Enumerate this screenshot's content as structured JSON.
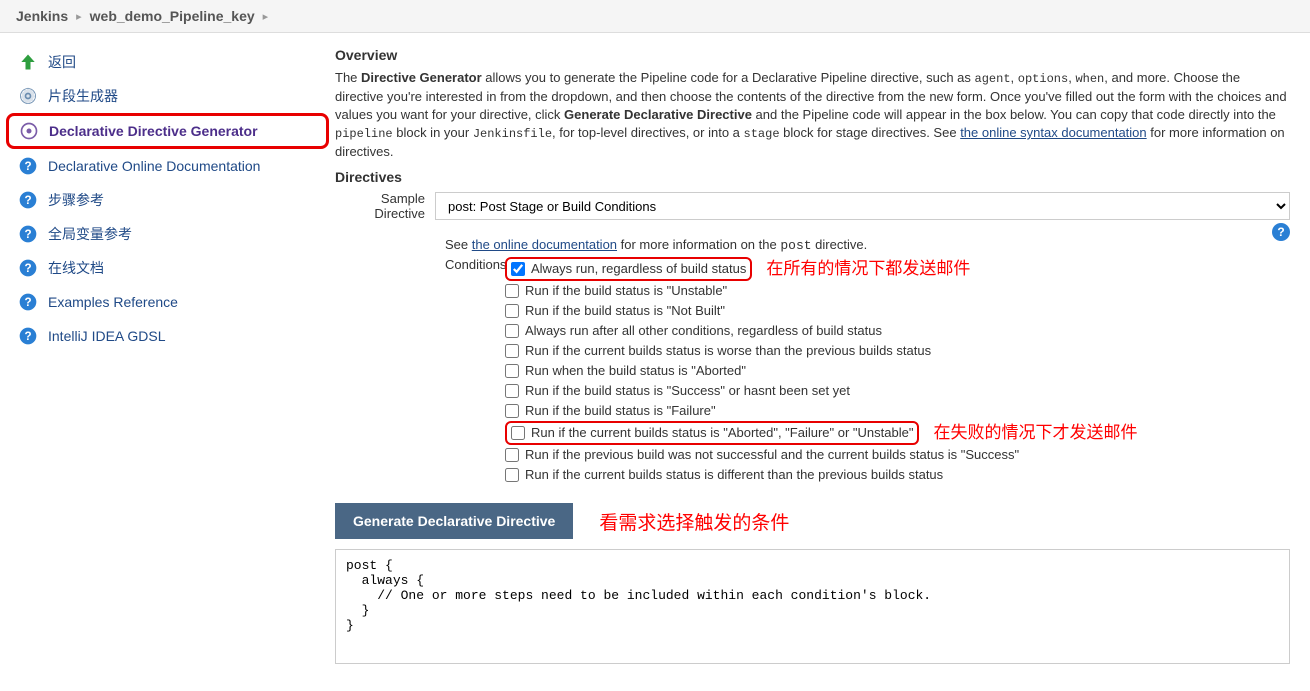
{
  "breadcrumb": {
    "root": "Jenkins",
    "item": "web_demo_Pipeline_key"
  },
  "sidebar": {
    "items": [
      {
        "label": "返回",
        "icon": "arrow-up"
      },
      {
        "label": "片段生成器",
        "icon": "gear"
      },
      {
        "label": "Declarative Directive Generator",
        "icon": "gear-purple",
        "highlighted": true
      },
      {
        "label": "Declarative Online Documentation",
        "icon": "help"
      },
      {
        "label": "步骤参考",
        "icon": "help"
      },
      {
        "label": "全局变量参考",
        "icon": "help"
      },
      {
        "label": "在线文档",
        "icon": "help"
      },
      {
        "label": "Examples Reference",
        "icon": "help"
      },
      {
        "label": "IntelliJ IDEA GDSL",
        "icon": "help"
      }
    ]
  },
  "overview": {
    "heading": "Overview",
    "text1_a": "The ",
    "text1_b": "Directive Generator",
    "text1_c": " allows you to generate the Pipeline code for a Declarative Pipeline directive, such as ",
    "code1": "agent",
    "code2": "options",
    "code3": "when",
    "text1_d": ", and more. Choose the directive you're interested in from the dropdown, and then choose the contents of the directive from the new form. Once you've filled out the form with the choices and values you want for your directive, click ",
    "text1_e": "Generate Declarative Directive",
    "text1_f": " and the Pipeline code will appear in the box below. You can copy that code directly into the ",
    "code4": "pipeline",
    "text1_g": " block in your ",
    "code5": "Jenkinsfile",
    "text1_h": ", for top-level directives, or into a ",
    "code6": "stage",
    "text1_i": " block for stage directives. See ",
    "link1": "the online syntax documentation",
    "text1_j": " for more information on directives."
  },
  "directives": {
    "heading": "Directives",
    "label": "Sample Directive",
    "selected": "post: Post Stage or Build Conditions"
  },
  "help": {
    "pre": "See ",
    "link": "the online documentation",
    "mid": " for more information on the ",
    "code": "post",
    "post": " directive."
  },
  "conditions": {
    "label": "Conditions",
    "items": [
      {
        "label": "Always run, regardless of build status",
        "checked": true,
        "boxed": true,
        "annot": "在所有的情况下都发送邮件"
      },
      {
        "label": "Run if the build status is \"Unstable\""
      },
      {
        "label": "Run if the build status is \"Not Built\""
      },
      {
        "label": "Always run after all other conditions, regardless of build status"
      },
      {
        "label": "Run if the current builds status is worse than the previous builds status"
      },
      {
        "label": "Run when the build status is \"Aborted\""
      },
      {
        "label": "Run if the build status is \"Success\" or hasnt been set yet"
      },
      {
        "label": "Run if the build status is \"Failure\""
      },
      {
        "label": "Run if the current builds status is \"Aborted\", \"Failure\" or \"Unstable\"",
        "boxed": true,
        "annot": "在失败的情况下才发送邮件"
      },
      {
        "label": "Run if the previous build was not successful and the current builds status is \"Success\""
      },
      {
        "label": "Run if the current builds status is different than the previous builds status"
      }
    ]
  },
  "generate": {
    "button": "Generate Declarative Directive",
    "annot": "看需求选择触发的条件"
  },
  "code_output": "post {\n  always {\n    // One or more steps need to be included within each condition's block.\n  }\n}"
}
